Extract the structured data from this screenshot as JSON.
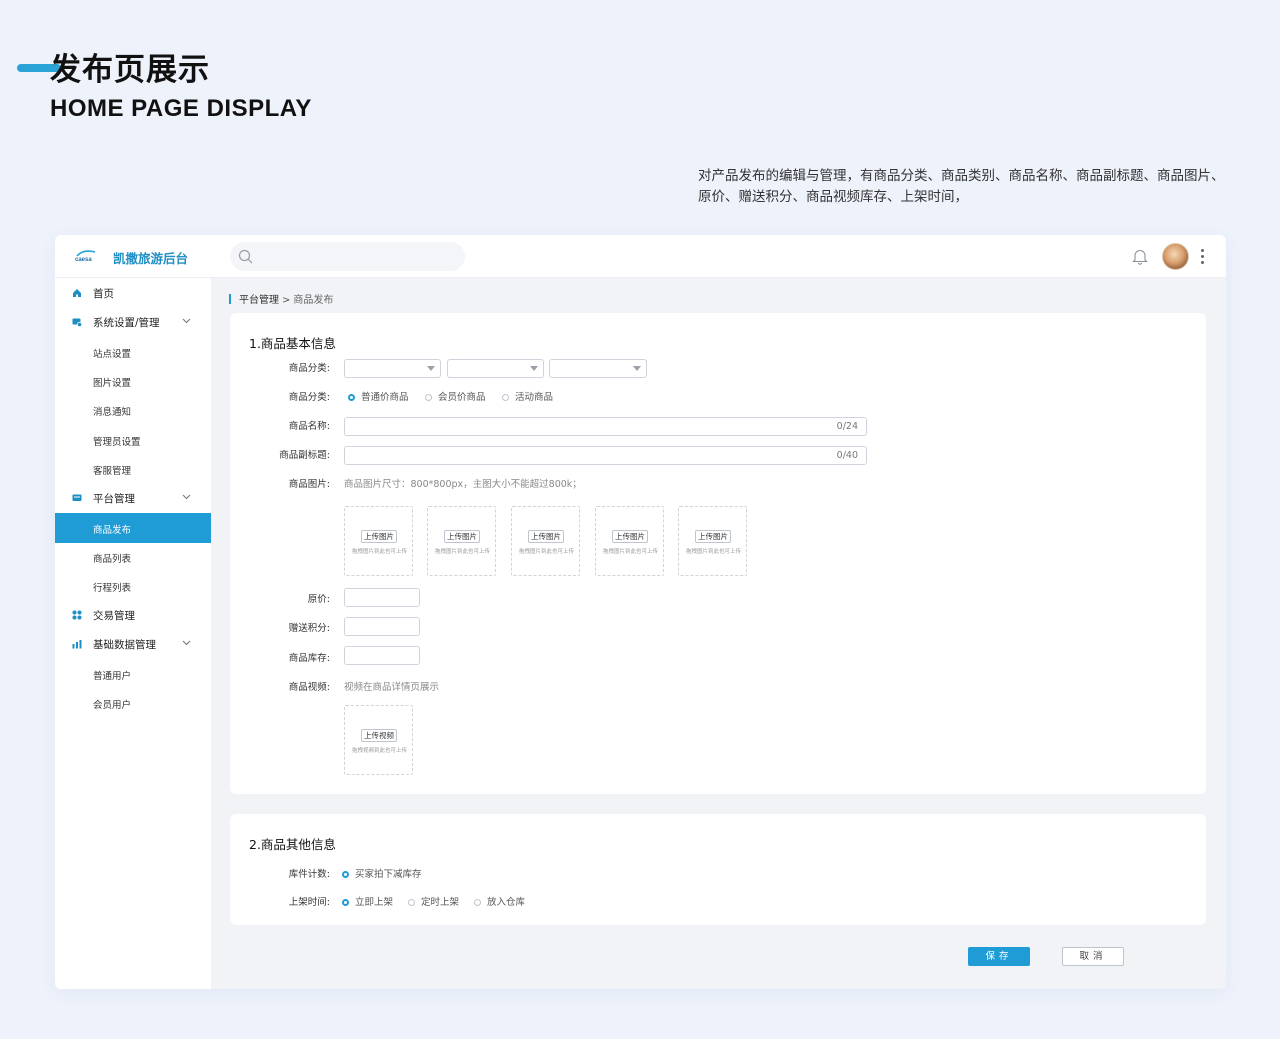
{
  "hero": {
    "title": "发布页展示",
    "subtitle": "HOME PAGE DISPLAY",
    "description": "对产品发布的编辑与管理，有商品分类、商品类别、商品名称、商品副标题、商品图片、原价、赠送积分、商品视频库存、上架时间，"
  },
  "topbar": {
    "logo_text": "caesa",
    "app_name": "凯撒旅游后台",
    "search_placeholder": ""
  },
  "sidebar": {
    "home": "首页",
    "system": "系统设置/管理",
    "system_items": [
      "站点设置",
      "图片设置",
      "消息通知",
      "管理员设置",
      "客服管理"
    ],
    "platform": "平台管理",
    "platform_items": [
      "商品发布",
      "商品列表",
      "行程列表"
    ],
    "trade": "交易管理",
    "basic": "基础数据管理",
    "basic_items": [
      "普通用户",
      "会员用户"
    ]
  },
  "breadcrumb": {
    "parent": "平台管理",
    "sep": ">",
    "current": "商品发布"
  },
  "section1": {
    "title": "1.商品基本信息",
    "category_label": "商品分类:",
    "type_label": "商品分类:",
    "type_options": [
      "普通价商品",
      "会员价商品",
      "活动商品"
    ],
    "name_label": "商品名称:",
    "name_count": "0/24",
    "subtitle_label": "商品副标题:",
    "subtitle_count": "0/40",
    "image_label": "商品图片:",
    "image_hint": "商品图片尺寸：800*800px，主图大小不能超过800k；",
    "upload_image_btn": "上传图片",
    "upload_image_hint": "拖拽图片到此也可上传",
    "price_label": "原价:",
    "points_label": "赠送积分:",
    "stock_label": "商品库存:",
    "video_label": "商品视频:",
    "video_hint": "视频在商品详情页展示",
    "upload_video_btn": "上传视频",
    "upload_video_hint": "拖拽视频到此也可上传"
  },
  "section2": {
    "title": "2.商品其他信息",
    "stock_count_label": "库件计数:",
    "stock_count_option": "买家拍下减库存",
    "listing_label": "上架时间:",
    "listing_options": [
      "立即上架",
      "定时上架",
      "放入仓库"
    ]
  },
  "actions": {
    "save": "保存",
    "cancel": "取消"
  }
}
